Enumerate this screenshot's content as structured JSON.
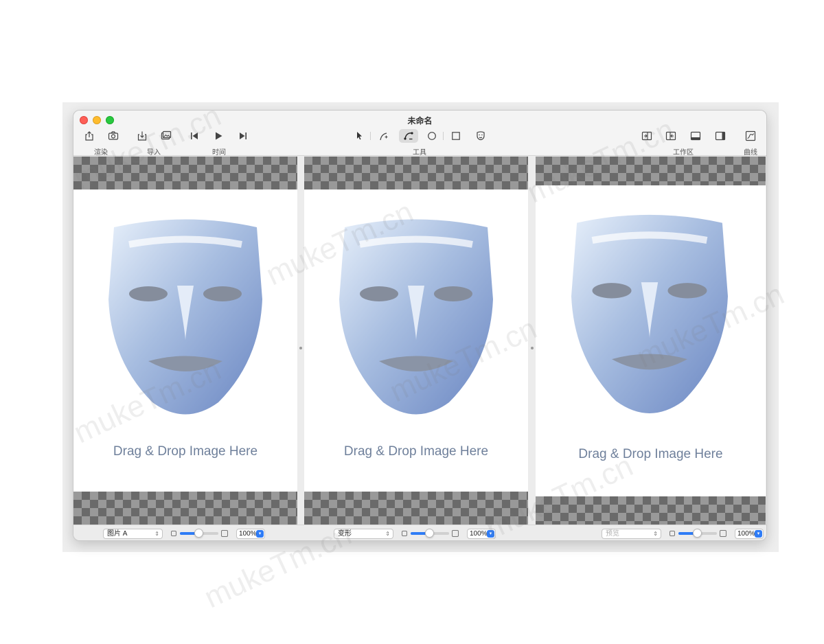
{
  "window": {
    "title": "未命名"
  },
  "toolbar": {
    "render_label": "渲染",
    "import_label": "导入",
    "time_label": "时间",
    "tools_label": "工具",
    "workspace_label": "工作区",
    "curve_label": "曲线"
  },
  "panes": [
    {
      "drop_text": "Drag & Drop Image Here",
      "popup_value": "图片 A",
      "zoom": "100%",
      "selected": true
    },
    {
      "drop_text": "Drag & Drop Image Here",
      "popup_value": "变形",
      "zoom": "100%",
      "selected": false
    },
    {
      "drop_text": "Drag & Drop Image Here",
      "popup_value": "预览",
      "zoom": "100%",
      "selected": false
    }
  ],
  "watermark": "mukeTm.cn",
  "colors": {
    "selection": "#1a73e8",
    "accent": "#2f7cf6",
    "drop_text": "#6f809b"
  }
}
